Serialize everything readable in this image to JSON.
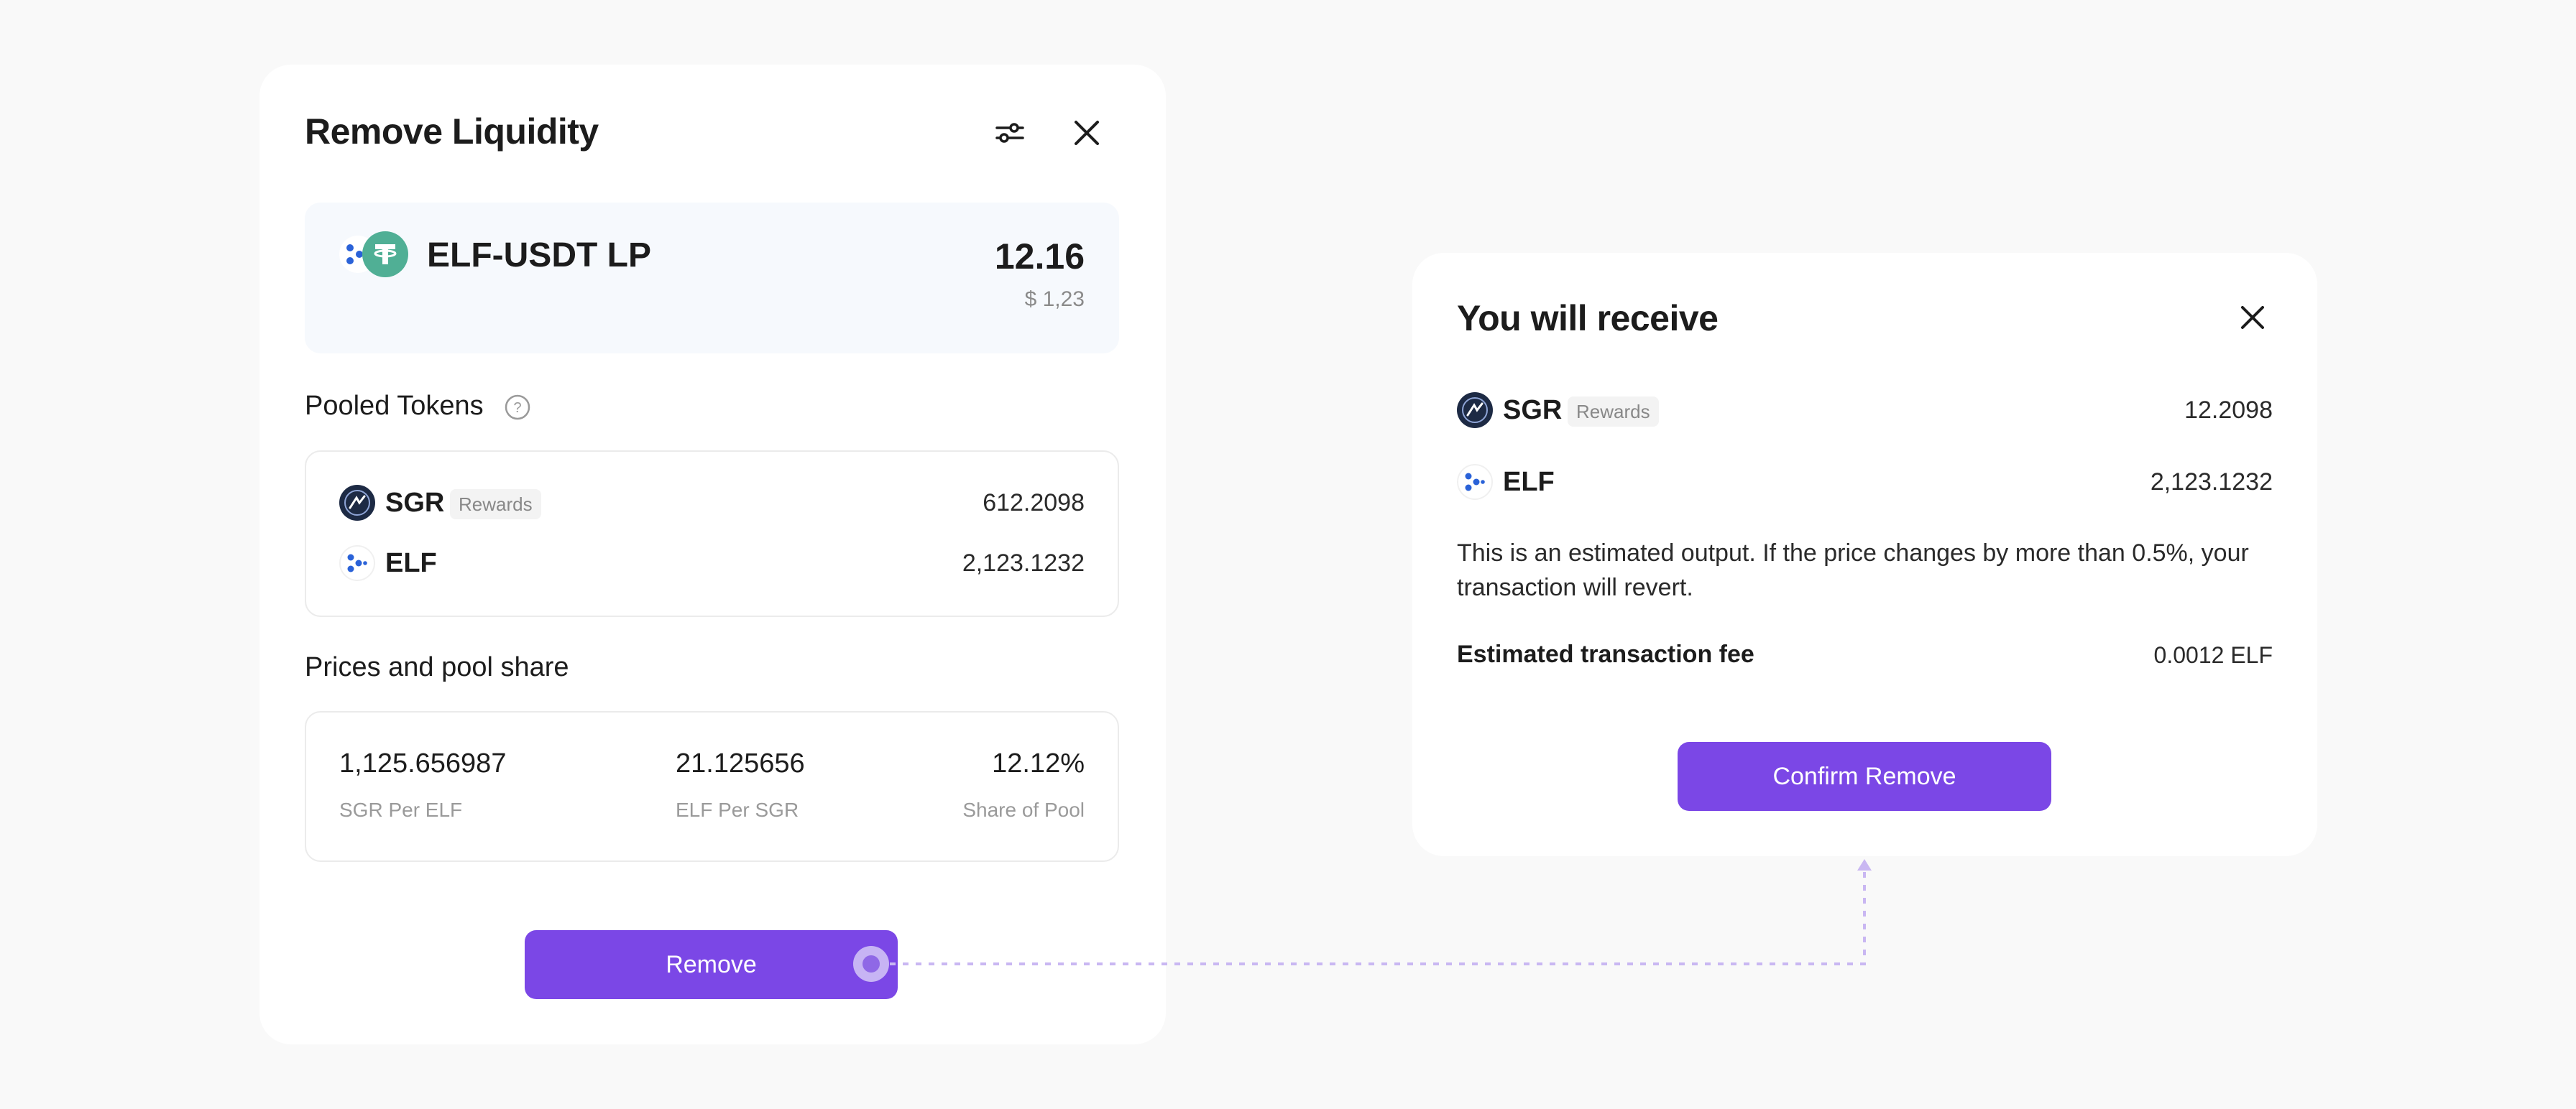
{
  "remove_dialog": {
    "title": "Remove Liquidity",
    "lp_token": {
      "name": "ELF-USDT LP",
      "amount": "12.16",
      "usd_value": "$ 1,23"
    },
    "pooled_tokens": {
      "title": "Pooled Tokens",
      "help_icon": "question-circle-icon",
      "items": [
        {
          "symbol": "SGR",
          "badge": "Rewards",
          "amount": "612.2098",
          "icon": "sgr-token-icon"
        },
        {
          "symbol": "ELF",
          "amount": "2,123.1232",
          "icon": "elf-token-icon"
        }
      ]
    },
    "prices": {
      "title": "Prices and pool share",
      "items": [
        {
          "value": "1,125.656987",
          "label": "SGR Per ELF"
        },
        {
          "value": "21.125656",
          "label": "ELF Per SGR"
        },
        {
          "value": "12.12%",
          "label": "Share of Pool"
        }
      ]
    },
    "remove_button": "Remove",
    "icons": {
      "settings": "sliders-icon",
      "close": "close-icon"
    }
  },
  "receive_dialog": {
    "title": "You will receive",
    "items": [
      {
        "symbol": "SGR",
        "badge": "Rewards",
        "amount": "12.2098",
        "icon": "sgr-token-icon"
      },
      {
        "symbol": "ELF",
        "amount": "2,123.1232",
        "icon": "elf-token-icon"
      }
    ],
    "note": "This is an estimated output. If the price changes by more than 0.5%, your transaction will revert.",
    "fee": {
      "label": "Estimated transaction fee",
      "value": "0.0012 ELF"
    },
    "confirm_button": "Confirm Remove"
  },
  "colors": {
    "accent": "#7b47e6",
    "background": "#f9f9f9",
    "usdt_green": "#50af95",
    "elf_blue": "#2a62d8",
    "sgr_dark": "#1d2a44",
    "connector": "#c9b7f2"
  }
}
